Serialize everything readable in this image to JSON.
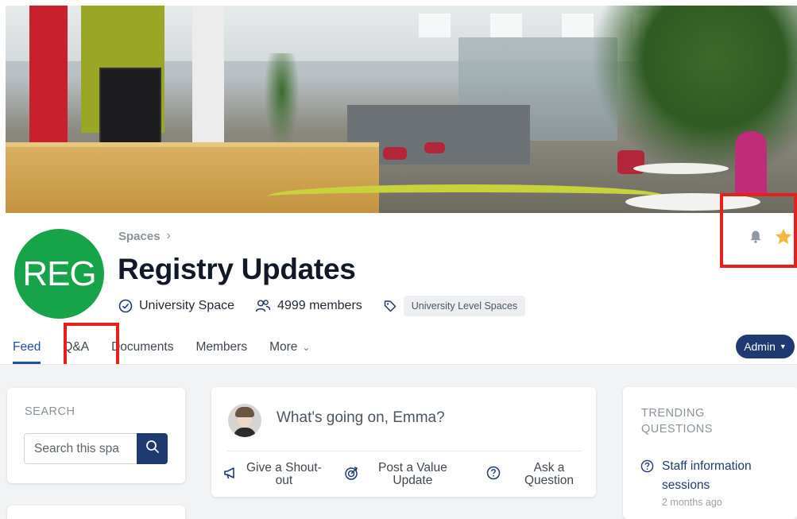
{
  "space": {
    "avatar_initials": "REG",
    "breadcrumb": "Spaces",
    "title": "Registry Updates",
    "type_label": "University Space",
    "members_label": "4999 members",
    "tag": "University Level Spaces"
  },
  "tabs": [
    {
      "label": "Feed",
      "active": true
    },
    {
      "label": "Q&A",
      "active": false
    },
    {
      "label": "Documents",
      "active": false
    },
    {
      "label": "Members",
      "active": false
    },
    {
      "label": "More",
      "active": false
    }
  ],
  "admin_button": "Admin",
  "search": {
    "label": "SEARCH",
    "placeholder": "Search this spa"
  },
  "post": {
    "prompt": "What's going on, Emma?",
    "actions": [
      {
        "line1": "Give a Shout-",
        "line2": "out",
        "icon": "megaphone-icon"
      },
      {
        "line1": "Post a Value",
        "line2": "Update",
        "icon": "target-icon"
      },
      {
        "line1": "Ask a",
        "line2": "Question",
        "icon": "question-icon"
      }
    ]
  },
  "trending": {
    "label_line1": "TRENDING",
    "label_line2": "QUESTIONS",
    "items": [
      {
        "line1": "Staff information",
        "line2": "sessions",
        "time": "2 months ago"
      }
    ]
  },
  "colors": {
    "accent": "#1e4ea8",
    "navy": "#1e3a70",
    "avatar_green": "#17a34a",
    "highlight_red": "#e8201b",
    "star_gold": "#f5b942"
  }
}
